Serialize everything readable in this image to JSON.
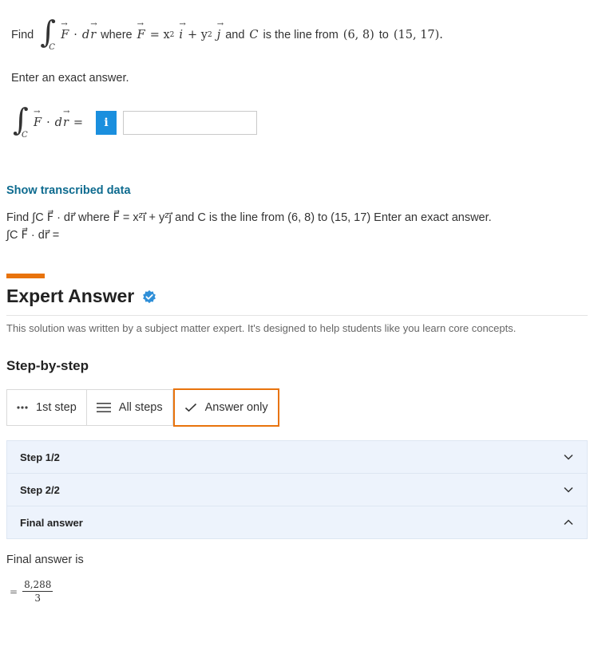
{
  "question": {
    "find_label": "Find",
    "integral_sub": "C",
    "vec_F": "F",
    "dot": "·",
    "d": "d",
    "vec_r": "r",
    "where_label": "where",
    "field_eq": "= x",
    "exp2a": "2",
    "vec_i": "i",
    "plus_y": "+ y",
    "exp2b": "2",
    "vec_j": "j",
    "and_label": "and",
    "curve_name": "C",
    "curve_text": "is the line from",
    "point_a": "(6, 8)",
    "to_label": "to",
    "point_b": "(15, 17).",
    "enter_exact": "Enter an exact answer.",
    "answer_eq": "=",
    "info_button": "i",
    "answer_value": ""
  },
  "transcribed": {
    "link": "Show transcribed data",
    "line1": "Find ∫C F⃗ · dr⃗ where F⃗ = x²i⃗ + y²j⃗ and C is the line from (6, 8) to (15, 17) Enter an exact answer.",
    "line2": "∫C F⃗ · dr⃗ ="
  },
  "expert": {
    "title": "Expert Answer",
    "note": "This solution was written by a subject matter expert. It's designed to help students like you learn core concepts."
  },
  "steps_section": {
    "title": "Step-by-step",
    "tabs": [
      {
        "label": "1st step",
        "icon": "dots-icon"
      },
      {
        "label": "All steps",
        "icon": "list-icon"
      },
      {
        "label": "Answer only",
        "icon": "check-icon"
      }
    ],
    "rows": [
      {
        "label": "Step 1/2",
        "chevron": "chevron-down-icon"
      },
      {
        "label": "Step 2/2",
        "chevron": "chevron-down-icon"
      },
      {
        "label": "Final answer",
        "chevron": "chevron-up-icon"
      }
    ]
  },
  "final": {
    "label": "Final answer is",
    "eq": "=",
    "numerator": "8,288",
    "denominator": "3"
  },
  "colors": {
    "accent": "#e8730c",
    "link": "#0e6b8f",
    "info": "#1a8fde",
    "step_bg": "#edf3fc"
  }
}
